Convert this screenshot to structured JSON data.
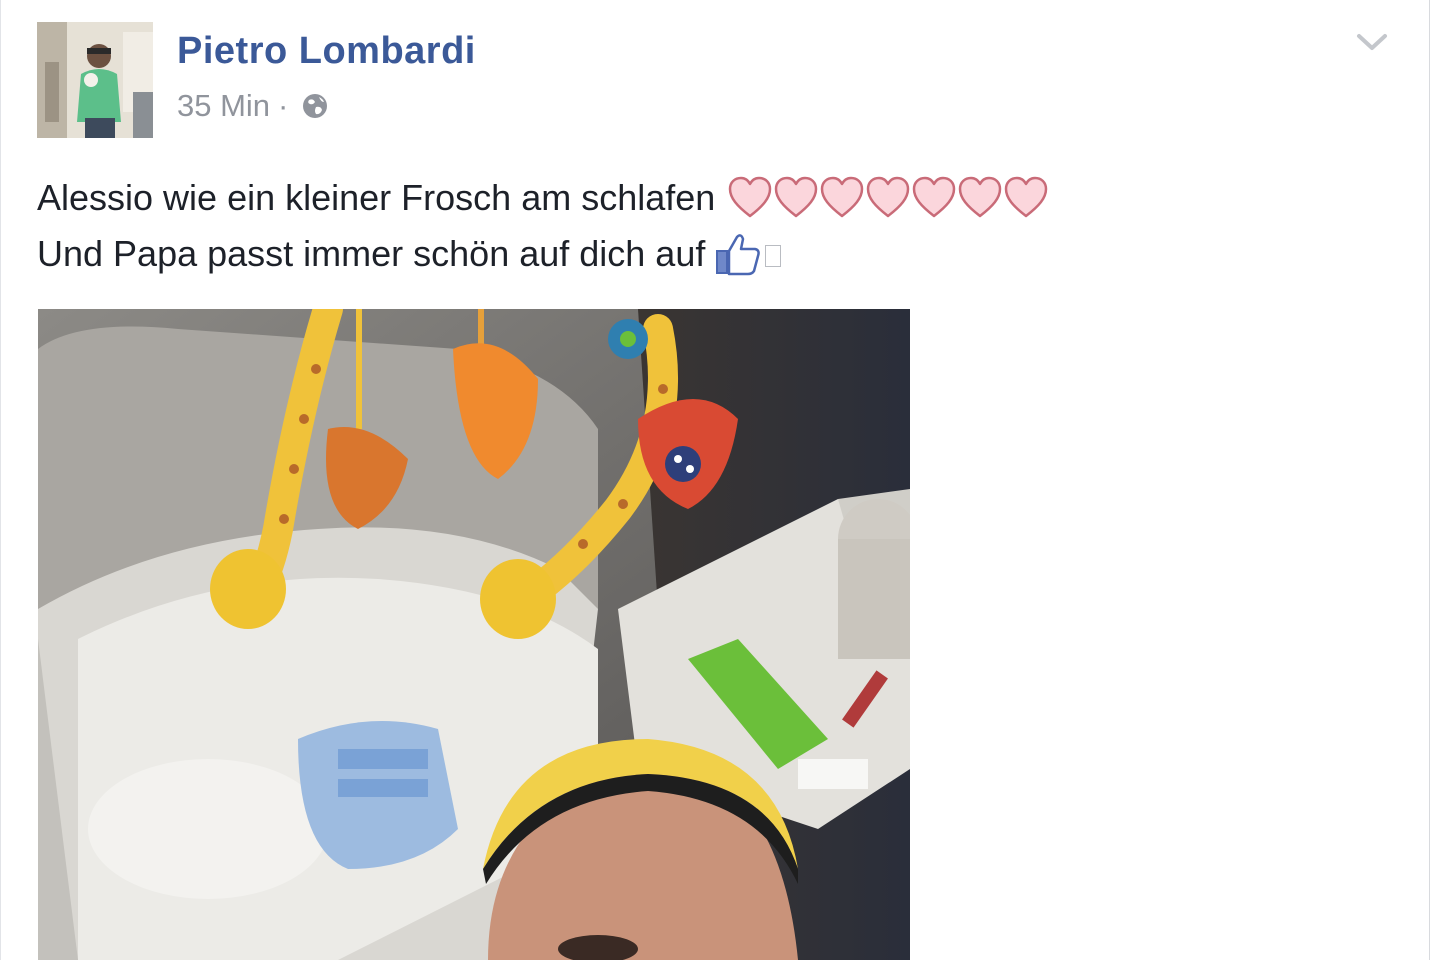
{
  "post": {
    "author": "Pietro Lombardi",
    "timestamp": "35 Min",
    "separator": "·",
    "privacy_icon": "globe-icon",
    "options_icon": "chevron-down-icon",
    "text_line1": "Alessio wie ein kleiner Frosch am schlafen",
    "text_line2": "Und Papa passt immer schön auf dich auf",
    "hearts_count": 7,
    "hearts_icon": "heart-icon",
    "thumb_icon": "thumbs-up-icon",
    "photo_icon": "photo"
  },
  "colors": {
    "author": "#3b5998",
    "meta": "#90949c",
    "text": "#1d2129",
    "heart_fill": "#fbd6dc",
    "heart_stroke": "#c96b78",
    "thumb": "#4a67b2"
  }
}
